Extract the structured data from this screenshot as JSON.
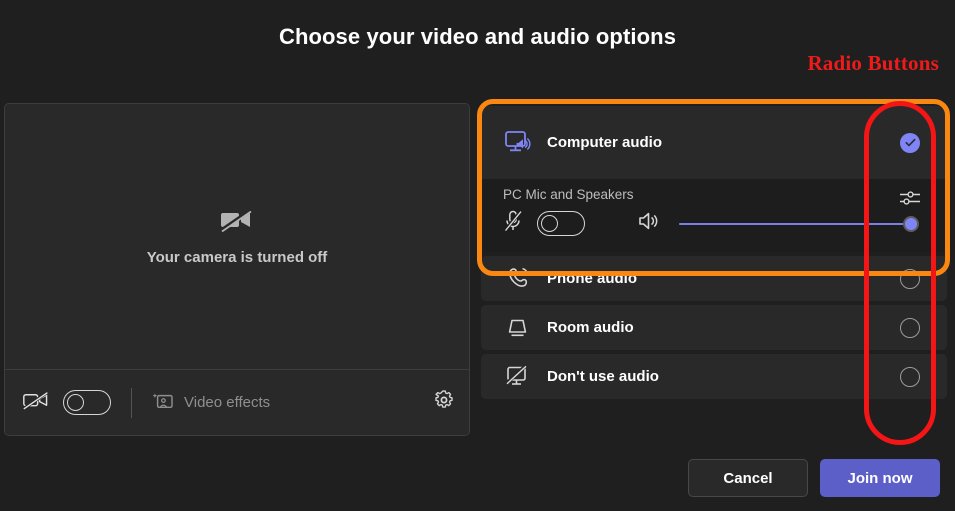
{
  "page": {
    "title": "Choose your video and audio options"
  },
  "annotations": [
    {
      "label": "Radio Buttons",
      "color": "#ee1b1b",
      "target": "radio-button-column"
    },
    {
      "label": "",
      "color": "#f98712",
      "target": "computer-audio-group"
    },
    {
      "label": "",
      "color": "#f41616",
      "target": "radio-button-column"
    }
  ],
  "video_panel": {
    "camera_off_text": "Your camera is turned off",
    "camera_off_icon": "camera-off-icon",
    "toolbar": {
      "camera_icon": "camera-off-icon",
      "camera_toggle": {
        "label": "",
        "state": "off"
      },
      "video_effects_icon": "video-effects-icon",
      "video_effects_label": "Video effects",
      "settings_icon": "gear-icon"
    }
  },
  "audio_options": {
    "selected": "computer-audio",
    "items": [
      {
        "id": "computer-audio",
        "label": "Computer audio",
        "icon": "monitor-speaker-icon",
        "selected": true,
        "device": {
          "name": "PC Mic and Speakers",
          "mic_icon": "microphone-muted-icon",
          "mic_toggle_state": "off",
          "speaker_icon": "speaker-icon",
          "volume_percent": 100,
          "settings_icon": "audio-settings-sliders-icon"
        }
      },
      {
        "id": "phone-audio",
        "label": "Phone audio",
        "icon": "phone-audio-icon",
        "selected": false
      },
      {
        "id": "room-audio",
        "label": "Room audio",
        "icon": "room-speaker-icon",
        "selected": false
      },
      {
        "id": "dont-use-audio",
        "label": "Don't use audio",
        "icon": "monitor-muted-icon",
        "selected": false
      }
    ]
  },
  "footer": {
    "cancel_label": "Cancel",
    "join_label": "Join now",
    "join_color": "#5b5fc7"
  }
}
